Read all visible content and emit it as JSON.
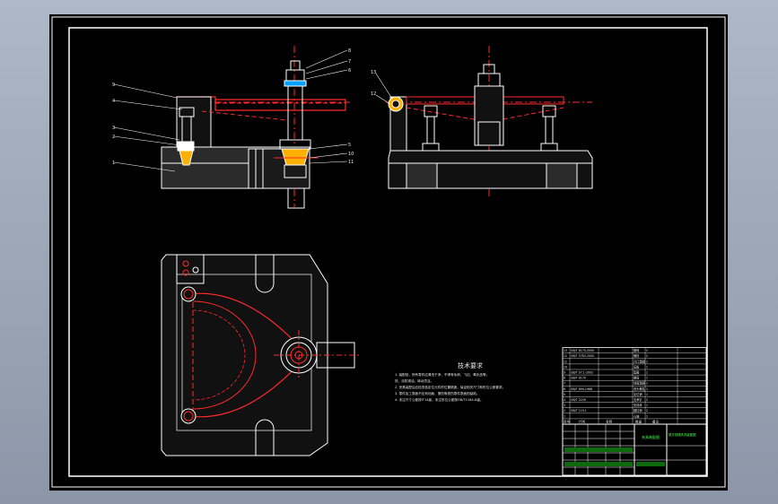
{
  "drawing": {
    "technical_requirements_title": "技术要求",
    "technical_requirements_lines": [
      "1. 装配前，所有零件应清洗干净，不得有毛刺、飞边、氧化皮等，",
      "铣，涂防锈油，转动灵活。",
      "2. 夹具装配后应检查各定位元件的位置精度，保证相关尺寸和形位公差要求。",
      "3. 零件加工表面不应有划痕、擦伤等损伤零件表面的缺陷。",
      "4. 未注尺寸公差按IT14级，未注形位公差按GB/T1184-K级。"
    ],
    "balloons_front": [
      "9",
      "4",
      "3",
      "2",
      "1"
    ],
    "balloons_front_right": [
      "8",
      "7",
      "6",
      "5",
      "10",
      "11"
    ],
    "balloons_side": [
      "13",
      "12"
    ],
    "bom_rows": [
      [
        "13",
        "GB/T 6170-2000",
        "螺母",
        "2",
        ""
      ],
      [
        "12",
        "GB/T 5783-2000",
        "螺栓",
        "2",
        ""
      ],
      [
        "11",
        "",
        "开口垫圈",
        "1",
        ""
      ],
      [
        "10",
        "",
        "压板",
        "1",
        ""
      ],
      [
        "9",
        "GB/T 97.1-2002",
        "垫圈",
        "1",
        ""
      ],
      [
        "8",
        "GB/T 6170",
        "螺母",
        "1",
        ""
      ],
      [
        "7",
        "",
        "球面垫圈",
        "1",
        ""
      ],
      [
        "6",
        "GB/T 899-1988",
        "双头螺柱",
        "1",
        ""
      ],
      [
        "5",
        "",
        "定位销",
        "1",
        ""
      ],
      [
        "4",
        "GB/T 2226",
        "支承钉",
        "2",
        ""
      ],
      [
        "3",
        "",
        "夹具体",
        "1",
        ""
      ],
      [
        "2",
        "GB/T 119.1",
        "圆柱销",
        "2",
        ""
      ],
      [
        "1",
        "",
        "心轴",
        "1",
        ""
      ]
    ],
    "bom_header": [
      "序号",
      "代号",
      "名称",
      "数量",
      "备注"
    ],
    "title_block": {
      "drawing_name": "夹具装配图",
      "subtitle": "拨叉铣槽夹具装配图"
    }
  },
  "colors": {
    "sheet": "#000000",
    "outline": "#ffffff",
    "red": "#ff2a2a",
    "green": "#4cff4c",
    "dark_gray": "#2b2b2b"
  }
}
